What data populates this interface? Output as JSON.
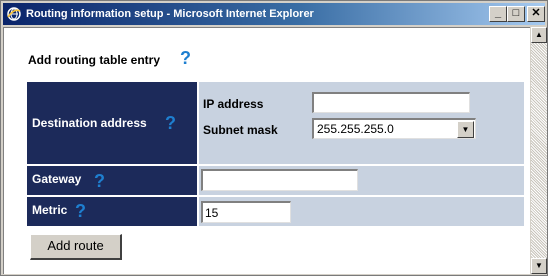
{
  "window": {
    "title": "Routing information setup - Microsoft Internet Explorer",
    "min_glyph": "_",
    "max_glyph": "□",
    "close_glyph": "✕",
    "scroll_up_glyph": "▲",
    "scroll_down_glyph": "▼"
  },
  "page": {
    "heading": "Add routing table entry",
    "help_glyph": "?"
  },
  "form": {
    "destination": {
      "label": "Destination address",
      "ip_label": "IP address",
      "ip_value": "",
      "mask_label": "Subnet mask",
      "mask_value": "255.255.255.0",
      "mask_arrow_glyph": "▼"
    },
    "gateway": {
      "label": "Gateway",
      "value": ""
    },
    "metric": {
      "label": "Metric",
      "value": "15"
    }
  },
  "actions": {
    "add_route_label": "Add route"
  },
  "colors": {
    "label_bg": "#1c2a5a",
    "value_bg": "#c8d2e0",
    "help_icon": "#1e7fd0",
    "titlebar_start": "#0a246a",
    "titlebar_end": "#a6caf0"
  }
}
